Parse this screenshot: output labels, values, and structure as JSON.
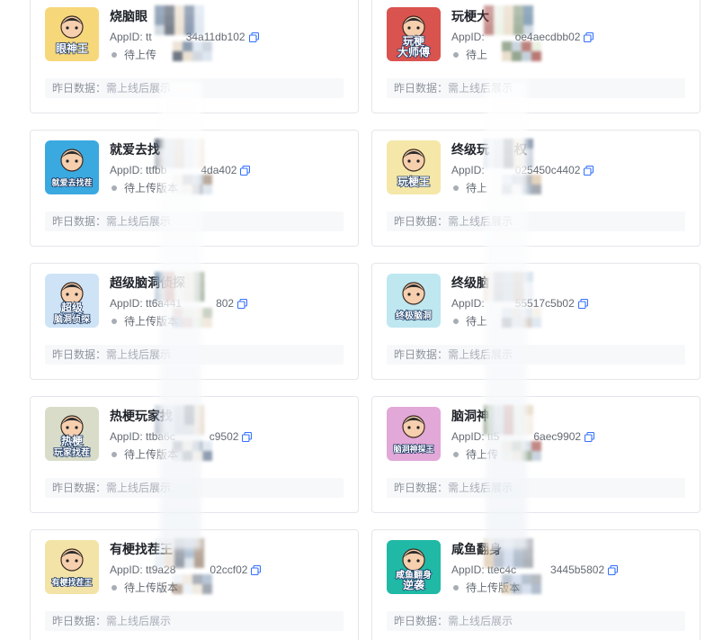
{
  "appid_prefix": "AppID: ",
  "footer": {
    "label": "昨日数据：",
    "value": "需上线后展示"
  },
  "cards": [
    {
      "name": "烧脑眼",
      "appid": "tt",
      "appid_tail": "34a11db102",
      "status": "待上传",
      "icon": "eye-king-icon",
      "icon_text": [
        "眼神王"
      ],
      "icon_bg": "#f6d77a"
    },
    {
      "name": "玩梗大",
      "appid": "",
      "appid_tail": "oe4aecdbb02",
      "status": "待上",
      "icon": "meme-master-icon",
      "icon_text": [
        "玩梗",
        "大师傅"
      ],
      "icon_bg": "#d9534f"
    },
    {
      "name": "就爱去找",
      "appid": "ttfbb",
      "appid_tail": "4da402",
      "status": "待上传版本",
      "icon": "find-diff-icon",
      "icon_text": [
        "就爱去找茬"
      ],
      "icon_bg": "#3aa9e0"
    },
    {
      "name": "终级玩",
      "appid": "",
      "appid_tail": "025450c4402",
      "status": "待上",
      "icon": "meme-king-icon",
      "icon_text": [
        "玩梗王"
      ],
      "icon_bg": "#f5e7a8",
      "name_tail": "权"
    },
    {
      "name": "超级脑洞侦探",
      "appid": "tt6a441",
      "appid_tail": "802",
      "status": "待上传版本",
      "icon": "detective-icon",
      "icon_text": [
        "超级",
        "脑洞侦探"
      ],
      "icon_bg": "#cfe3f6"
    },
    {
      "name": "终级脑",
      "appid": "",
      "appid_tail": "55517c5b02",
      "status": "待上",
      "icon": "brain-hole-icon",
      "icon_text": [
        "终极脑洞"
      ],
      "icon_bg": "#bfe7f0"
    },
    {
      "name": "热梗玩家找",
      "appid": "ttba6c",
      "appid_tail": "c9502",
      "status": "待上传版本",
      "icon": "meme-player-icon",
      "icon_text": [
        "热梗",
        "玩家找茬"
      ],
      "icon_bg": "#d8dcc9"
    },
    {
      "name": "脑洞神",
      "appid": "tt5",
      "appid_tail": "6aec9902",
      "status": "待上传",
      "icon": "brain-god-icon",
      "icon_text": [
        "脑洞神探王"
      ],
      "icon_bg": "#e2a8d8"
    },
    {
      "name": "有梗找茬王",
      "appid": "tt9a28",
      "appid_tail": "02ccf02",
      "status": "待上传版本",
      "icon": "find-king-icon",
      "icon_text": [
        "有梗找茬王"
      ],
      "icon_bg": "#f3e3a6"
    },
    {
      "name": "咸鱼翻身",
      "appid": "ttec4c",
      "appid_tail": "3445b5802",
      "status": "待上传版本",
      "icon": "salted-fish-icon",
      "icon_text": [
        "咸鱼翻身",
        "逆袭"
      ],
      "icon_bg": "#1fb9a6"
    }
  ]
}
